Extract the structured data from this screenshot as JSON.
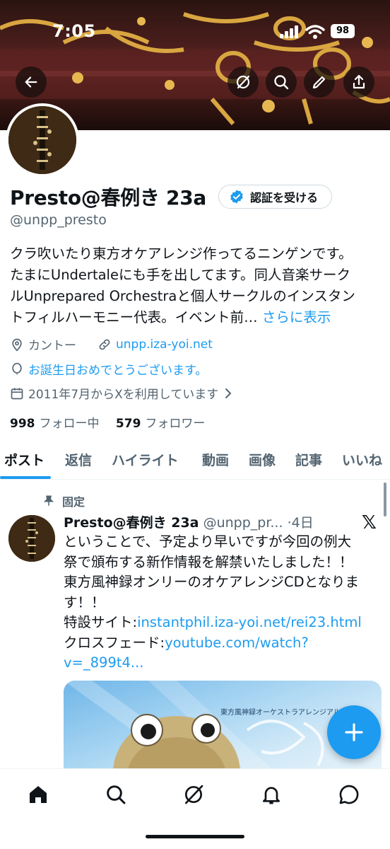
{
  "status_bar": {
    "time": "7:05",
    "battery": "98"
  },
  "profile": {
    "name": "Presto@春例き 23a",
    "verify_label": "認証を受ける",
    "handle": "@unpp_presto",
    "bio_lines": [
      "クラ吹いたり東方オケアレンジ作ってるニンゲンです。",
      "たまにUndertaleにも手を出してます。同人音楽サーク",
      "ルUnprepared Orchestraと個人サークルのインスタン",
      "トフィルハーモニー代表。イベント前… "
    ],
    "bio_more": "さらに表示",
    "location": "カントー",
    "website": "unpp.iza-yoi.net",
    "birthday": "お誕生日おめでとうございます。",
    "joined": "2011年7月からXを利用しています",
    "following_count": "998",
    "following_label": "フォロー中",
    "followers_count": "579",
    "followers_label": "フォロワー"
  },
  "tabs": [
    "ポスト",
    "返信",
    "ハイライト",
    "動画",
    "画像",
    "記事",
    "いいね"
  ],
  "pinned_post": {
    "pinned_label": "固定",
    "author_name": "Presto@春例き 23a",
    "author_handle": "@unpp_pr...",
    "time": "·4日",
    "body_lines": [
      "ということで、予定より早いですが今回の例大",
      "祭で頒布する新作情報を解禁いたしました！！",
      "東方風神録オンリーのオケアレンジCDとなりま",
      "す！！"
    ],
    "special_site_label": "特設サイト:",
    "special_site_link": "instantphil.iza-yoi.net/rei23.html",
    "crossfade_label": "クロスフェード:",
    "crossfade_link_1": "youtube.com/watch?",
    "crossfade_link_2": "v=_899t4...",
    "image_caption": "東方風神録オーケストラアレンジアルバム"
  },
  "icons": {
    "back": "arrow-left-icon",
    "grok": "grok-icon",
    "search": "search-icon",
    "edit": "pencil-icon",
    "share": "share-icon",
    "compose": "plus-icon",
    "nav": [
      "home-icon",
      "search-icon",
      "grok-icon",
      "bell-icon",
      "message-icon"
    ]
  },
  "colors": {
    "accent": "#1d9bf0",
    "text": "#0f1419",
    "secondary": "#536471"
  }
}
